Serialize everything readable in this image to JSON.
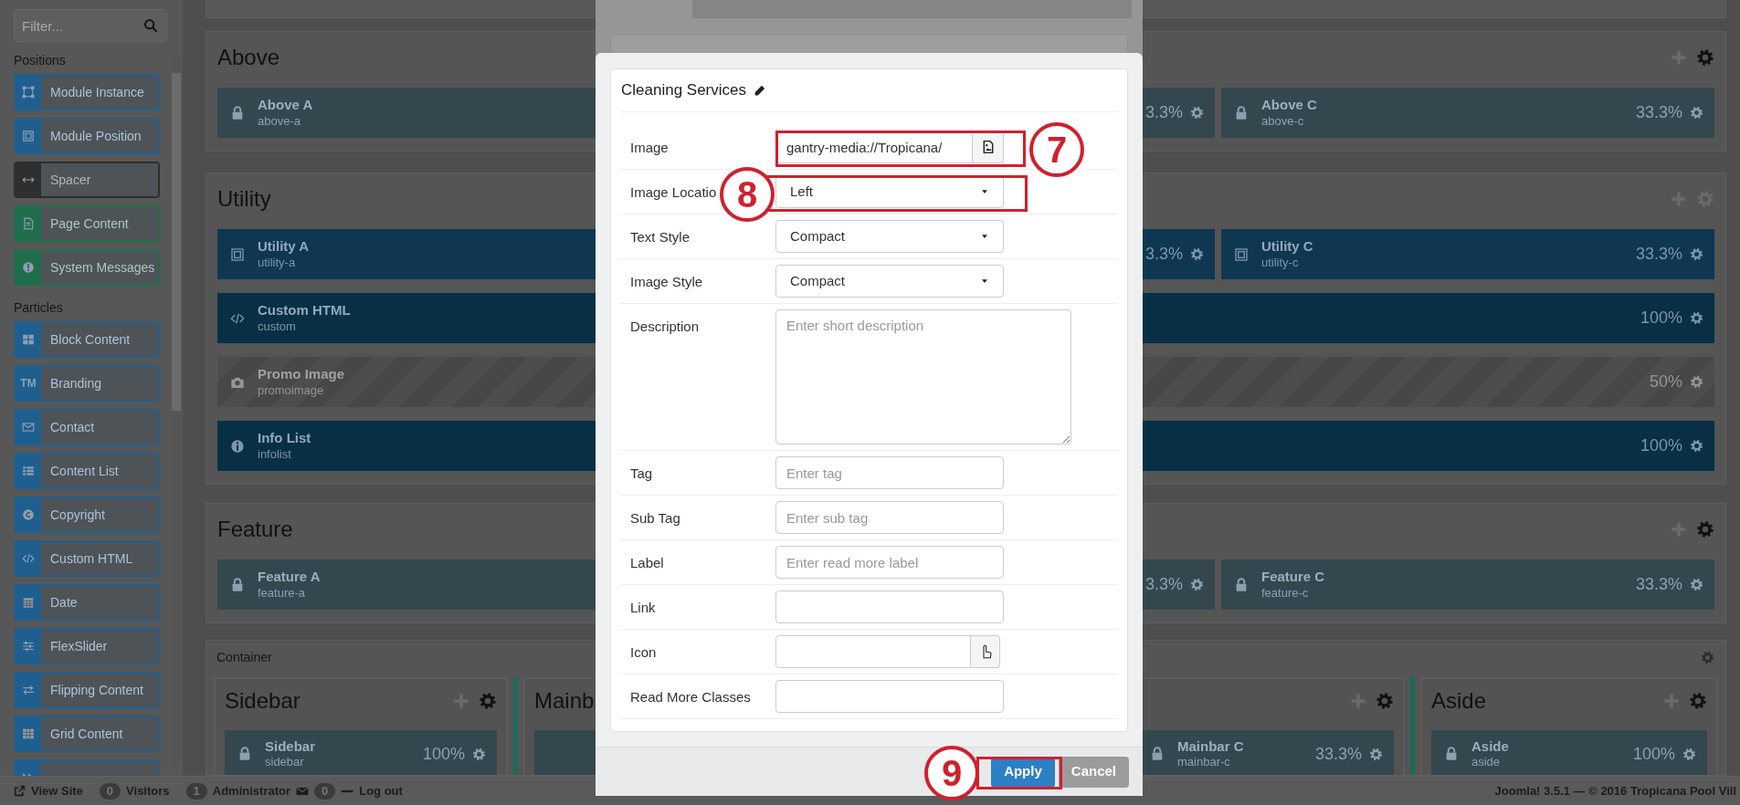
{
  "sidebar": {
    "filter": {
      "placeholder": "Filter..."
    },
    "groups": [
      {
        "title": "Positions",
        "items": [
          {
            "label": "Module Instance",
            "color": "#1f5f8f"
          },
          {
            "label": "Module Position",
            "color": "#1f5f8f"
          },
          {
            "label": "Spacer",
            "color": "#2f2f2f"
          },
          {
            "label": "Page Content",
            "color": "#1e6e4c"
          },
          {
            "label": "System Messages",
            "color": "#1e6e4c"
          }
        ]
      },
      {
        "title": "Particles",
        "items": [
          {
            "label": "Block Content",
            "color": "#1f5f8f"
          },
          {
            "label": "Branding",
            "color": "#1f5f8f",
            "glyph": "TM"
          },
          {
            "label": "Contact",
            "color": "#1f5f8f"
          },
          {
            "label": "Content List",
            "color": "#1f5f8f"
          },
          {
            "label": "Copyright",
            "color": "#1f5f8f"
          },
          {
            "label": "Custom HTML",
            "color": "#1f5f8f"
          },
          {
            "label": "Date",
            "color": "#1f5f8f"
          },
          {
            "label": "FlexSlider",
            "color": "#1f5f8f"
          },
          {
            "label": "Flipping Content",
            "color": "#1f5f8f"
          },
          {
            "label": "Grid Content",
            "color": "#1f5f8f"
          },
          {
            "color": "#1f5f8f"
          }
        ]
      }
    ]
  },
  "sections": [
    {
      "title": "Above",
      "gear_active": true,
      "rows": [
        {
          "kind": "thirds",
          "blocks": [
            {
              "kind": "locked",
              "title": "Above A",
              "subtitle": "above-a"
            },
            {
              "kind": "locked",
              "size": "3.3%"
            },
            {
              "kind": "locked",
              "title": "Above C",
              "subtitle": "above-c",
              "size": "33.3%"
            }
          ]
        }
      ]
    },
    {
      "title": "Utility",
      "gear_active": false,
      "rows": [
        {
          "kind": "thirds",
          "blocks": [
            {
              "kind": "module",
              "title": "Utility A",
              "subtitle": "utility-a"
            },
            {
              "kind": "module",
              "size": "3.3%"
            },
            {
              "kind": "module",
              "title": "Utility C",
              "subtitle": "utility-c",
              "size": "33.3%"
            }
          ]
        },
        {
          "kind": "full",
          "blocks": [
            {
              "kind": "html",
              "title": "Custom HTML",
              "subtitle": "custom",
              "size": "100%"
            }
          ]
        },
        {
          "kind": "full",
          "blocks": [
            {
              "kind": "image",
              "title": "Promo Image",
              "subtitle": "promoimage",
              "size": "50%"
            }
          ]
        },
        {
          "kind": "full",
          "blocks": [
            {
              "kind": "info",
              "title": "Info List",
              "subtitle": "infolist",
              "size": "100%"
            }
          ]
        }
      ]
    },
    {
      "title": "Feature",
      "gear_active": true,
      "rows": [
        {
          "kind": "thirds",
          "blocks": [
            {
              "kind": "locked",
              "title": "Feature A",
              "subtitle": "feature-a"
            },
            {
              "kind": "locked",
              "size": "3.3%"
            },
            {
              "kind": "locked",
              "title": "Feature C",
              "subtitle": "feature-c",
              "size": "33.3%"
            }
          ]
        }
      ]
    }
  ],
  "container": {
    "label": "Container",
    "columns": [
      {
        "title": "Sidebar",
        "blocks": [
          {
            "kind": "locked",
            "title": "Sidebar",
            "subtitle": "sidebar",
            "size": "100%"
          }
        ]
      },
      {
        "title": "Mainb",
        "blocks": [
          {
            "kind": "locked"
          },
          {
            "kind": "locked",
            "title": "Mainbar C",
            "subtitle": "mainbar-c",
            "size": "33.3%"
          }
        ]
      },
      {
        "title": "Aside",
        "blocks": [
          {
            "kind": "locked",
            "title": "Aside",
            "subtitle": "aside",
            "size": "100%"
          }
        ]
      }
    ]
  },
  "modal": {
    "title": "Cleaning Services",
    "fields": [
      {
        "label": "Image",
        "kind": "picker",
        "value": "gantry-media://Tropicana/"
      },
      {
        "label": "Image Locatio",
        "kind": "select",
        "value": "Left"
      },
      {
        "label": "Text Style",
        "kind": "select",
        "value": "Compact"
      },
      {
        "label": "Image Style",
        "kind": "select",
        "value": "Compact"
      },
      {
        "label": "Description",
        "kind": "textarea",
        "placeholder": "Enter short description"
      },
      {
        "label": "Tag",
        "kind": "text",
        "placeholder": "Enter tag"
      },
      {
        "label": "Sub Tag",
        "kind": "text",
        "placeholder": "Enter sub tag"
      },
      {
        "label": "Label",
        "kind": "text",
        "placeholder": "Enter read more label"
      },
      {
        "label": "Link",
        "kind": "text"
      },
      {
        "label": "Icon",
        "kind": "iconpicker"
      },
      {
        "label": "Read More Classes",
        "kind": "text"
      }
    ],
    "buttons": [
      {
        "label": "Apply",
        "kind": "primary"
      },
      {
        "label": "Cancel",
        "kind": "secondary"
      }
    ]
  },
  "annotations": [
    {
      "number": "7"
    },
    {
      "number": "8"
    },
    {
      "number": "9"
    }
  ],
  "status_bar": {
    "left": [
      {
        "kind": "link",
        "text": "View Site"
      },
      {
        "kind": "count",
        "count": "0",
        "text": "Visitors"
      },
      {
        "kind": "count",
        "count": "1",
        "text": "Administrator"
      },
      {
        "kind": "mail",
        "count": "0"
      },
      {
        "kind": "logout",
        "text": "Log out"
      }
    ],
    "right": "Joomla! 3.5.1 — © 2016 Tropicana Pool Vill"
  }
}
